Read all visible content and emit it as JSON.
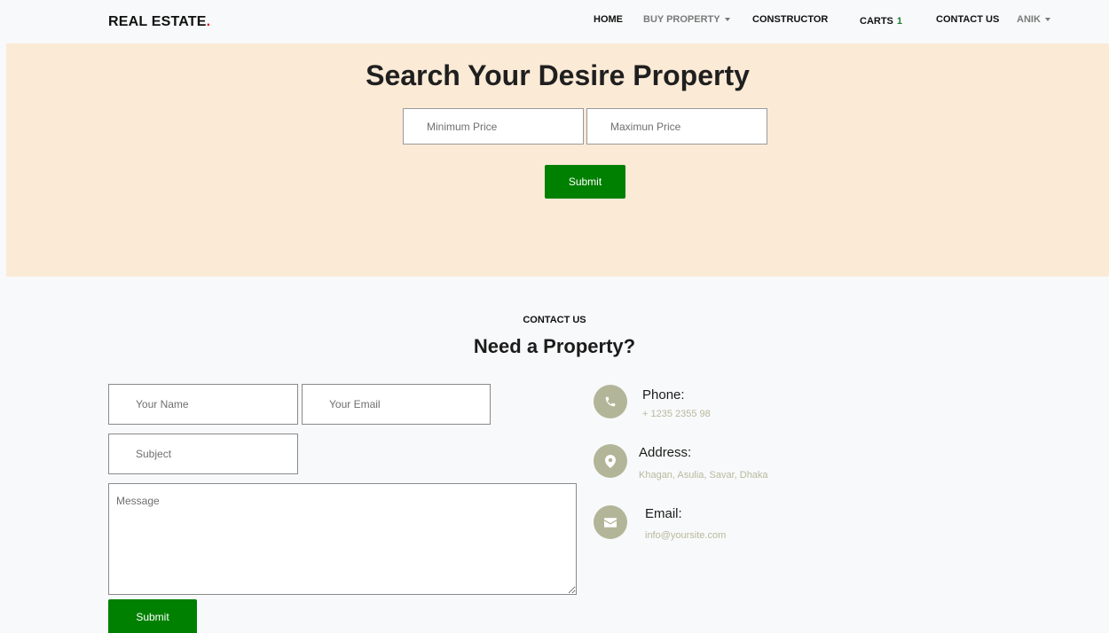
{
  "navbar": {
    "brand": "REAL ESTATE",
    "brand_dot": ".",
    "items": [
      {
        "label": "HOME"
      },
      {
        "label": "BUY PROPERTY"
      },
      {
        "label": "CONSTRUCTOR"
      },
      {
        "label": "CARTS",
        "count": "1"
      },
      {
        "label": "CONTACT US"
      },
      {
        "label": "ANIK"
      }
    ]
  },
  "hero": {
    "title": "Search Your Desire Property",
    "min_placeholder": "Minimum Price",
    "max_placeholder": "Maximun Price",
    "submit_label": "Submit"
  },
  "contact": {
    "eyebrow": "CONTACT US",
    "title": "Need a Property?",
    "name_placeholder": "Your Name",
    "email_placeholder": "Your Email",
    "subject_placeholder": "Subject",
    "message_placeholder": "Message",
    "submit_label": "Submit",
    "info": [
      {
        "title": "Phone:",
        "value": "+ 1235 2355 98",
        "icon": "phone-icon"
      },
      {
        "title": "Address:",
        "value": "Khagan, Asulia, Savar, Dhaka",
        "icon": "map-pin-icon"
      },
      {
        "title": "Email:",
        "value": "info@yoursite.com",
        "icon": "envelope-icon"
      }
    ]
  },
  "colors": {
    "hero_bg": "#fbead6",
    "accent_green": "#008000",
    "icon_bg": "#b3b598",
    "brand_dot": "#e0201b"
  }
}
